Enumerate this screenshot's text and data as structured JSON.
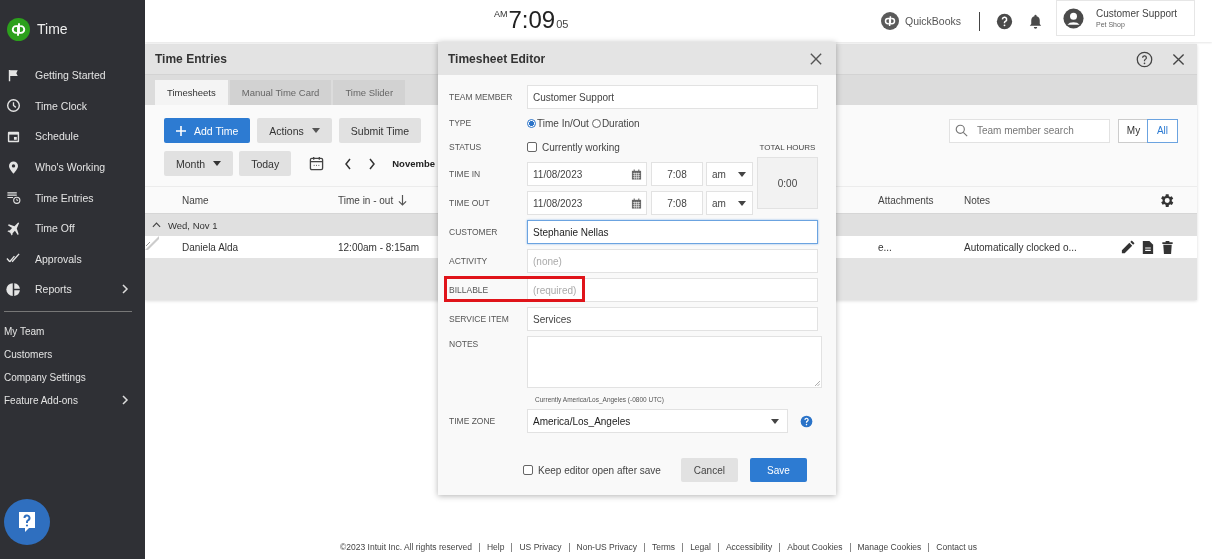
{
  "app": {
    "name": "Time"
  },
  "sidebar": {
    "items": [
      {
        "kind": "flag",
        "label": "Getting Started",
        "has_submenu": false
      },
      {
        "kind": "clock",
        "label": "Time Clock",
        "has_submenu": false
      },
      {
        "kind": "calendar",
        "label": "Schedule",
        "has_submenu": false
      },
      {
        "kind": "pin",
        "label": "Who's Working",
        "has_submenu": false
      },
      {
        "kind": "entries",
        "label": "Time Entries",
        "has_submenu": false
      },
      {
        "kind": "plane",
        "label": "Time Off",
        "has_submenu": false
      },
      {
        "kind": "checks",
        "label": "Approvals",
        "has_submenu": false
      },
      {
        "kind": "pie",
        "label": "Reports",
        "has_submenu": true
      }
    ],
    "links": [
      {
        "label": "My Team",
        "has_submenu": false
      },
      {
        "label": "Customers",
        "has_submenu": false
      },
      {
        "label": "Company Settings",
        "has_submenu": false
      },
      {
        "label": "Feature Add-ons",
        "has_submenu": true
      }
    ]
  },
  "clock": {
    "meridiem": "AM",
    "time": "7:09",
    "seconds": "05"
  },
  "header": {
    "quickbooks": "QuickBooks",
    "user": {
      "name": "Customer Support",
      "company": "Pet Shop"
    }
  },
  "time_entries": {
    "title": "Time Entries",
    "tabs": [
      {
        "label": "Timesheets",
        "selected": true
      },
      {
        "label": "Manual Time Card",
        "selected": false
      },
      {
        "label": "Time Slider",
        "selected": false
      }
    ],
    "buttons": {
      "add": "Add Time",
      "actions": "Actions",
      "submit": "Submit Time"
    },
    "search": {
      "placeholder": "Team member search"
    },
    "scope": [
      {
        "label": "My",
        "selected": false
      },
      {
        "label": "All",
        "selected": true
      }
    ],
    "view": "Month",
    "today": "Today",
    "period": "Novembe",
    "columns": {
      "name": "Name",
      "time": "Time in - out",
      "attachments": "Attachments",
      "notes": "Notes"
    },
    "group": {
      "label": "Wed, Nov 1",
      "expanded": true
    },
    "rows": [
      {
        "name": "Daniela Alda",
        "time": "12:00am - 8:15am",
        "column_3": "e...",
        "notes": "Automatically clocked o..."
      }
    ]
  },
  "editor": {
    "title": "Timesheet Editor",
    "team_member": {
      "label": "TEAM MEMBER",
      "value": "Customer Support"
    },
    "type": {
      "label": "TYPE",
      "options": [
        {
          "label": "Time In/Out",
          "selected": true
        },
        {
          "label": "Duration",
          "selected": false
        }
      ]
    },
    "status": {
      "label": "STATUS",
      "option": "Currently working",
      "checked": false
    },
    "total_hours": {
      "label": "TOTAL HOURS",
      "value": "0:00"
    },
    "time_in": {
      "label": "TIME IN",
      "date": "11/08/2023",
      "time": "7:08",
      "meridiem": "am"
    },
    "time_out": {
      "label": "TIME OUT",
      "date": "11/08/2023",
      "time": "7:08",
      "meridiem": "am"
    },
    "customer": {
      "label": "CUSTOMER",
      "value": "Stephanie Nellas",
      "focused": true
    },
    "activity": {
      "label": "ACTIVITY",
      "placeholder": "(none)"
    },
    "billable": {
      "label": "BILLABLE",
      "placeholder": "(required)",
      "highlighted": true
    },
    "service_item": {
      "label": "SERVICE ITEM",
      "value": "Services"
    },
    "notes": {
      "label": "NOTES"
    },
    "timezone_note": "Currently America/Los_Angeles (-0800 UTC)",
    "time_zone": {
      "label": "TIME ZONE",
      "value": "America/Los_Angeles"
    },
    "keep_open": {
      "label": "Keep editor open after save",
      "checked": false
    },
    "cancel": "Cancel",
    "save": "Save"
  },
  "footer": {
    "copyright": "©2023 Intuit Inc. All rights reserved",
    "links": [
      "Help",
      "US Privacy",
      "Non-US Privacy",
      "Terms",
      "Legal",
      "Accessibility",
      "About Cookies",
      "Manage Cookies",
      "Contact us"
    ]
  }
}
